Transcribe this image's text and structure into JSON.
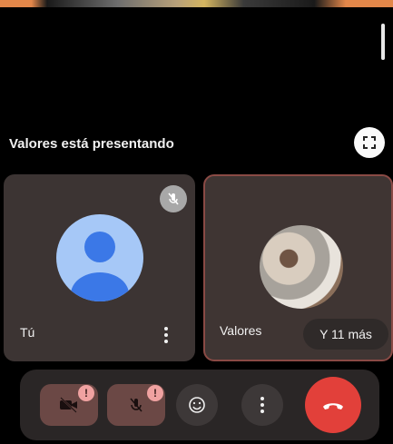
{
  "presentation": {
    "status_text": "Valores está presentando"
  },
  "tiles": {
    "you": {
      "name": "Tú",
      "muted": true
    },
    "valores": {
      "name": "Valores",
      "more_label": "Y 11 más"
    }
  },
  "controls": {
    "camera": {
      "alert": "!"
    },
    "microphone": {
      "alert": "!"
    }
  },
  "colors": {
    "end_call": "#e2403a",
    "tile_bg": "#3c3433",
    "avatar_blue": "#a6c8f7",
    "avatar_dark_blue": "#3b78e7"
  }
}
